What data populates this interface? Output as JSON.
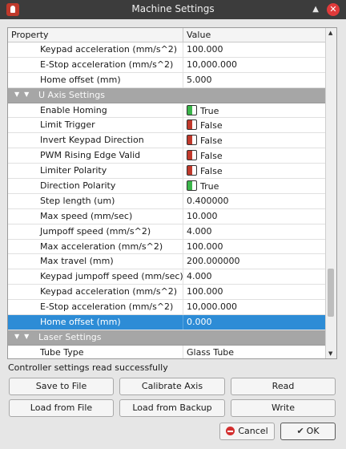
{
  "window": {
    "title": "Machine Settings",
    "maximize_glyph": "▲",
    "close_glyph": "✕"
  },
  "table": {
    "headers": [
      "Property",
      "Value"
    ],
    "rows": [
      {
        "type": "item",
        "label": "Keypad acceleration (mm/s^2)",
        "value": "100.000"
      },
      {
        "type": "item",
        "label": "E-Stop acceleration (mm/s^2)",
        "value": "10,000.000"
      },
      {
        "type": "item",
        "label": "Home offset (mm)",
        "value": "5.000"
      },
      {
        "type": "group",
        "label": "U Axis Settings"
      },
      {
        "type": "bool",
        "label": "Enable Homing",
        "value": "True",
        "state": "on"
      },
      {
        "type": "bool",
        "label": "Limit Trigger",
        "value": "False",
        "state": "off"
      },
      {
        "type": "bool",
        "label": "Invert Keypad Direction",
        "value": "False",
        "state": "off"
      },
      {
        "type": "bool",
        "label": "PWM Rising Edge Valid",
        "value": "False",
        "state": "off"
      },
      {
        "type": "bool",
        "label": "Limiter Polarity",
        "value": "False",
        "state": "off"
      },
      {
        "type": "bool",
        "label": "Direction Polarity",
        "value": "True",
        "state": "on"
      },
      {
        "type": "item",
        "label": "Step length (um)",
        "value": "0.400000"
      },
      {
        "type": "item",
        "label": "Max speed (mm/sec)",
        "value": "10.000"
      },
      {
        "type": "item",
        "label": "Jumpoff speed (mm/s^2)",
        "value": "4.000"
      },
      {
        "type": "item",
        "label": "Max acceleration (mm/s^2)",
        "value": "100.000"
      },
      {
        "type": "item",
        "label": "Max travel (mm)",
        "value": "200.000000"
      },
      {
        "type": "item",
        "label": "Keypad jumpoff speed (mm/sec)",
        "value": "4.000"
      },
      {
        "type": "item",
        "label": "Keypad acceleration (mm/s^2)",
        "value": "100.000"
      },
      {
        "type": "item",
        "label": "E-Stop acceleration (mm/s^2)",
        "value": "10,000.000"
      },
      {
        "type": "item",
        "label": "Home offset (mm)",
        "value": "0.000",
        "selected": true
      },
      {
        "type": "group",
        "label": "Laser Settings"
      },
      {
        "type": "item",
        "label": "Tube Type",
        "value": "Glass Tube"
      }
    ]
  },
  "status": "Controller settings read successfully",
  "buttons": {
    "save_to_file": "Save to File",
    "calibrate_axis": "Calibrate Axis",
    "read": "Read",
    "load_from_file": "Load from File",
    "load_from_backup": "Load from Backup",
    "write": "Write",
    "cancel": "Cancel",
    "ok": "OK"
  },
  "colors": {
    "selection": "#2d8cd6",
    "group_row": "#a6a6a6",
    "switch_on": "#3bb54a",
    "switch_off": "#c0392b",
    "titlebar": "#3c3c3c"
  }
}
